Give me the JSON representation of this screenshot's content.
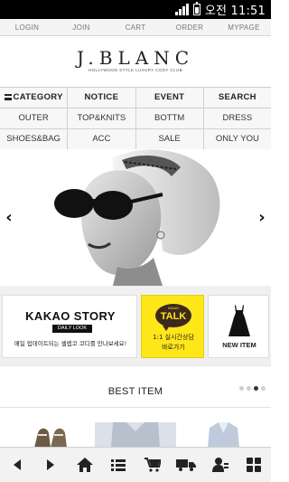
{
  "status_bar": {
    "time": "오전 11:51"
  },
  "top_menu": [
    "LOGIN",
    "JOIN",
    "CART",
    "ORDER",
    "MYPAGE"
  ],
  "logo": {
    "text": "J.BLANC",
    "tagline": "HOLLYWOOD STYLE LUXURY CODY CLUB"
  },
  "category_header": [
    "CATEGORY",
    "NOTICE",
    "EVENT",
    "SEARCH"
  ],
  "category_row1": [
    "OUTER",
    "TOP&KNITS",
    "BOTTM",
    "DRESS"
  ],
  "category_row2": [
    "SHOES&BAG",
    "ACC",
    "SALE",
    "ONLY YOU"
  ],
  "banner": {
    "prev_icon": "chevron-left-icon",
    "next_icon": "chevron-right-icon"
  },
  "promos": {
    "kakao_story": {
      "title": "KAKAO STORY",
      "subtitle": "DAILY LOOK",
      "desc": "매일 업데이트되는 셀렙코 코디를 만나보세요!"
    },
    "kakao_talk": {
      "small": "KAKAO",
      "big": "TALK",
      "line1": "1:1 실시간상담",
      "line2": "바로가기"
    },
    "new_item": {
      "label": "NEW ITEM"
    }
  },
  "best_item": {
    "title": "BEST ITEM",
    "pager_count": 4,
    "pager_active": 3
  },
  "bottom_nav": [
    "back-icon",
    "forward-icon",
    "home-icon",
    "list-icon",
    "cart-icon",
    "delivery-truck-icon",
    "account-icon",
    "grid-icon"
  ],
  "colors": {
    "kakao_yellow": "#ffe619",
    "kakao_brown": "#3c2a1e",
    "status_bar": "#000000"
  }
}
